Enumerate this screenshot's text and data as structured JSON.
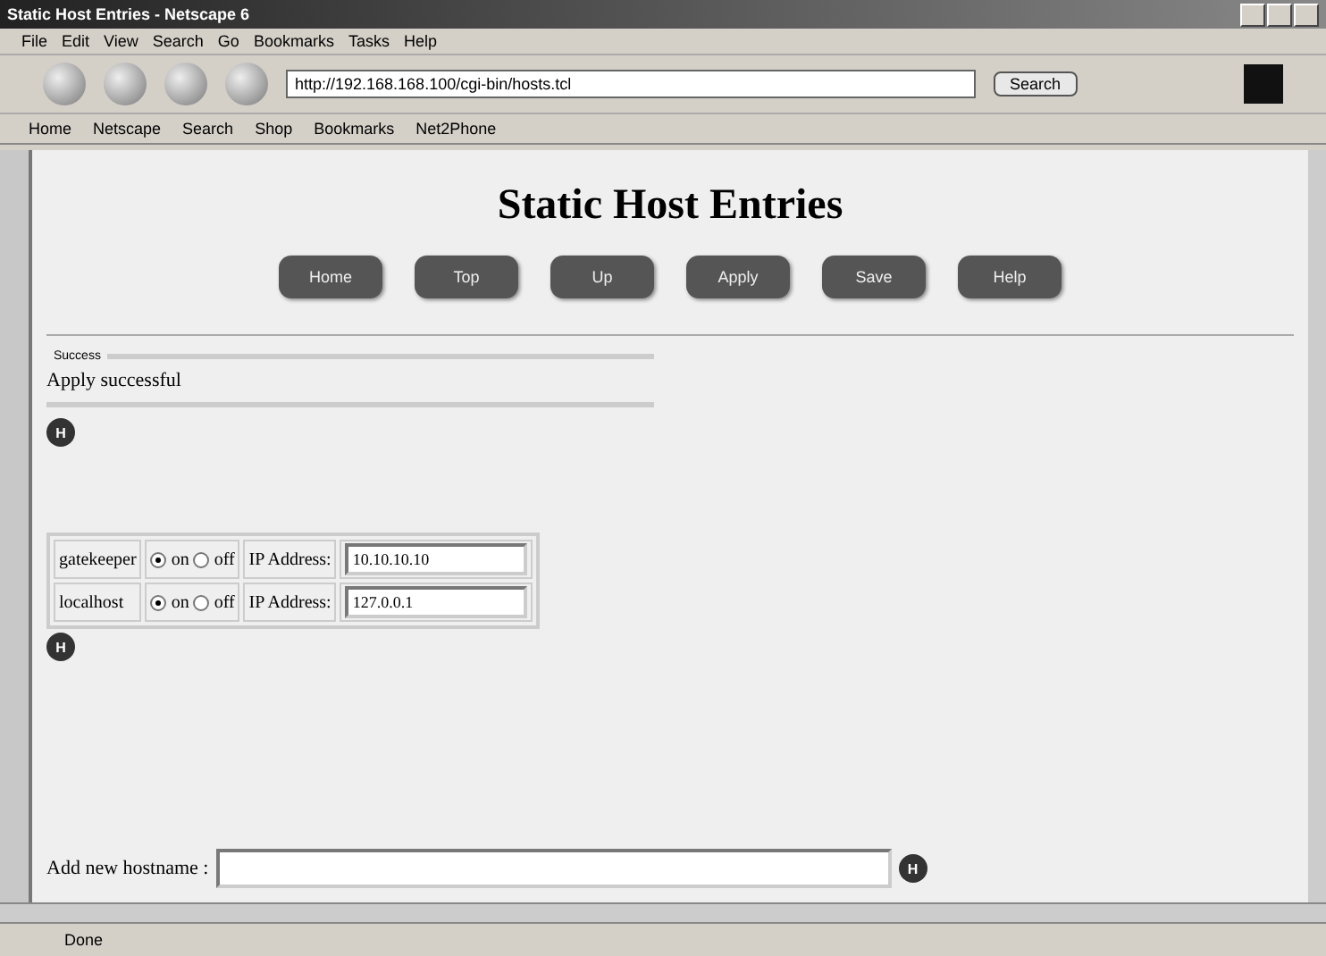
{
  "window": {
    "title": "Static Host Entries - Netscape 6"
  },
  "menu": [
    "File",
    "Edit",
    "View",
    "Search",
    "Go",
    "Bookmarks",
    "Tasks",
    "Help"
  ],
  "address": {
    "value": "http://192.168.168.100/cgi-bin/hosts.tcl"
  },
  "search_button": "Search",
  "personal_bar": [
    "Home",
    "Netscape",
    "Search",
    "Shop",
    "Bookmarks",
    "Net2Phone"
  ],
  "page": {
    "heading": "Static Host Entries",
    "nav_buttons": [
      "Home",
      "Top",
      "Up",
      "Apply",
      "Save",
      "Help"
    ],
    "message": {
      "legend": "Success",
      "text": "Apply successful"
    },
    "message_hint": "H",
    "hosts_hint": "H",
    "add_hint": "H",
    "hosts": [
      {
        "name": "gatekeeper",
        "on": true,
        "on_label": "on",
        "off_label": "off",
        "ip_label": "IP Address:",
        "ip": "10.10.10.10"
      },
      {
        "name": "localhost",
        "on": true,
        "on_label": "on",
        "off_label": "off",
        "ip_label": "IP Address:",
        "ip": "127.0.0.1"
      }
    ],
    "add_label": "Add new hostname :"
  },
  "status_bar": {
    "text": "Done"
  }
}
